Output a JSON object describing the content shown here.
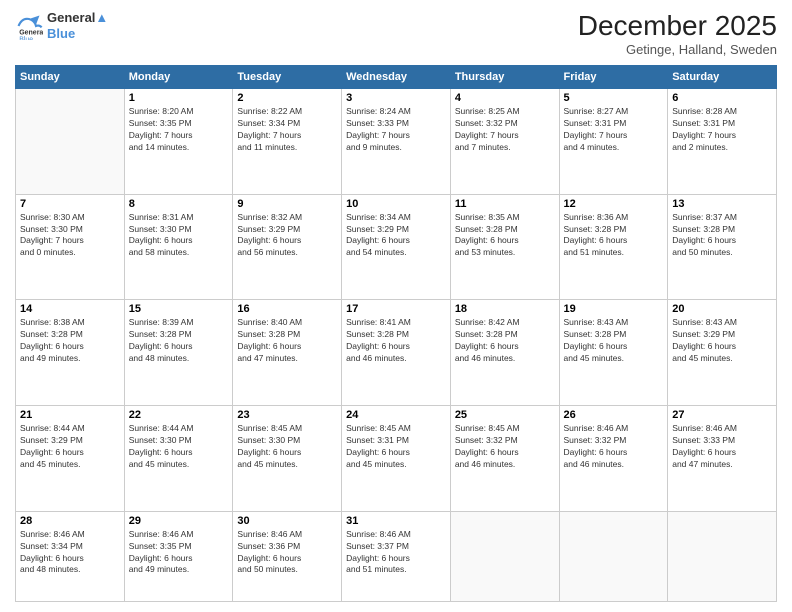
{
  "logo": {
    "line1": "General",
    "line2": "Blue"
  },
  "title": "December 2025",
  "location": "Getinge, Halland, Sweden",
  "days_of_week": [
    "Sunday",
    "Monday",
    "Tuesday",
    "Wednesday",
    "Thursday",
    "Friday",
    "Saturday"
  ],
  "weeks": [
    [
      {
        "day": "",
        "info": ""
      },
      {
        "day": "1",
        "info": "Sunrise: 8:20 AM\nSunset: 3:35 PM\nDaylight: 7 hours\nand 14 minutes."
      },
      {
        "day": "2",
        "info": "Sunrise: 8:22 AM\nSunset: 3:34 PM\nDaylight: 7 hours\nand 11 minutes."
      },
      {
        "day": "3",
        "info": "Sunrise: 8:24 AM\nSunset: 3:33 PM\nDaylight: 7 hours\nand 9 minutes."
      },
      {
        "day": "4",
        "info": "Sunrise: 8:25 AM\nSunset: 3:32 PM\nDaylight: 7 hours\nand 7 minutes."
      },
      {
        "day": "5",
        "info": "Sunrise: 8:27 AM\nSunset: 3:31 PM\nDaylight: 7 hours\nand 4 minutes."
      },
      {
        "day": "6",
        "info": "Sunrise: 8:28 AM\nSunset: 3:31 PM\nDaylight: 7 hours\nand 2 minutes."
      }
    ],
    [
      {
        "day": "7",
        "info": "Sunrise: 8:30 AM\nSunset: 3:30 PM\nDaylight: 7 hours\nand 0 minutes."
      },
      {
        "day": "8",
        "info": "Sunrise: 8:31 AM\nSunset: 3:30 PM\nDaylight: 6 hours\nand 58 minutes."
      },
      {
        "day": "9",
        "info": "Sunrise: 8:32 AM\nSunset: 3:29 PM\nDaylight: 6 hours\nand 56 minutes."
      },
      {
        "day": "10",
        "info": "Sunrise: 8:34 AM\nSunset: 3:29 PM\nDaylight: 6 hours\nand 54 minutes."
      },
      {
        "day": "11",
        "info": "Sunrise: 8:35 AM\nSunset: 3:28 PM\nDaylight: 6 hours\nand 53 minutes."
      },
      {
        "day": "12",
        "info": "Sunrise: 8:36 AM\nSunset: 3:28 PM\nDaylight: 6 hours\nand 51 minutes."
      },
      {
        "day": "13",
        "info": "Sunrise: 8:37 AM\nSunset: 3:28 PM\nDaylight: 6 hours\nand 50 minutes."
      }
    ],
    [
      {
        "day": "14",
        "info": "Sunrise: 8:38 AM\nSunset: 3:28 PM\nDaylight: 6 hours\nand 49 minutes."
      },
      {
        "day": "15",
        "info": "Sunrise: 8:39 AM\nSunset: 3:28 PM\nDaylight: 6 hours\nand 48 minutes."
      },
      {
        "day": "16",
        "info": "Sunrise: 8:40 AM\nSunset: 3:28 PM\nDaylight: 6 hours\nand 47 minutes."
      },
      {
        "day": "17",
        "info": "Sunrise: 8:41 AM\nSunset: 3:28 PM\nDaylight: 6 hours\nand 46 minutes."
      },
      {
        "day": "18",
        "info": "Sunrise: 8:42 AM\nSunset: 3:28 PM\nDaylight: 6 hours\nand 46 minutes."
      },
      {
        "day": "19",
        "info": "Sunrise: 8:43 AM\nSunset: 3:28 PM\nDaylight: 6 hours\nand 45 minutes."
      },
      {
        "day": "20",
        "info": "Sunrise: 8:43 AM\nSunset: 3:29 PM\nDaylight: 6 hours\nand 45 minutes."
      }
    ],
    [
      {
        "day": "21",
        "info": "Sunrise: 8:44 AM\nSunset: 3:29 PM\nDaylight: 6 hours\nand 45 minutes."
      },
      {
        "day": "22",
        "info": "Sunrise: 8:44 AM\nSunset: 3:30 PM\nDaylight: 6 hours\nand 45 minutes."
      },
      {
        "day": "23",
        "info": "Sunrise: 8:45 AM\nSunset: 3:30 PM\nDaylight: 6 hours\nand 45 minutes."
      },
      {
        "day": "24",
        "info": "Sunrise: 8:45 AM\nSunset: 3:31 PM\nDaylight: 6 hours\nand 45 minutes."
      },
      {
        "day": "25",
        "info": "Sunrise: 8:45 AM\nSunset: 3:32 PM\nDaylight: 6 hours\nand 46 minutes."
      },
      {
        "day": "26",
        "info": "Sunrise: 8:46 AM\nSunset: 3:32 PM\nDaylight: 6 hours\nand 46 minutes."
      },
      {
        "day": "27",
        "info": "Sunrise: 8:46 AM\nSunset: 3:33 PM\nDaylight: 6 hours\nand 47 minutes."
      }
    ],
    [
      {
        "day": "28",
        "info": "Sunrise: 8:46 AM\nSunset: 3:34 PM\nDaylight: 6 hours\nand 48 minutes."
      },
      {
        "day": "29",
        "info": "Sunrise: 8:46 AM\nSunset: 3:35 PM\nDaylight: 6 hours\nand 49 minutes."
      },
      {
        "day": "30",
        "info": "Sunrise: 8:46 AM\nSunset: 3:36 PM\nDaylight: 6 hours\nand 50 minutes."
      },
      {
        "day": "31",
        "info": "Sunrise: 8:46 AM\nSunset: 3:37 PM\nDaylight: 6 hours\nand 51 minutes."
      },
      {
        "day": "",
        "info": ""
      },
      {
        "day": "",
        "info": ""
      },
      {
        "day": "",
        "info": ""
      }
    ]
  ]
}
